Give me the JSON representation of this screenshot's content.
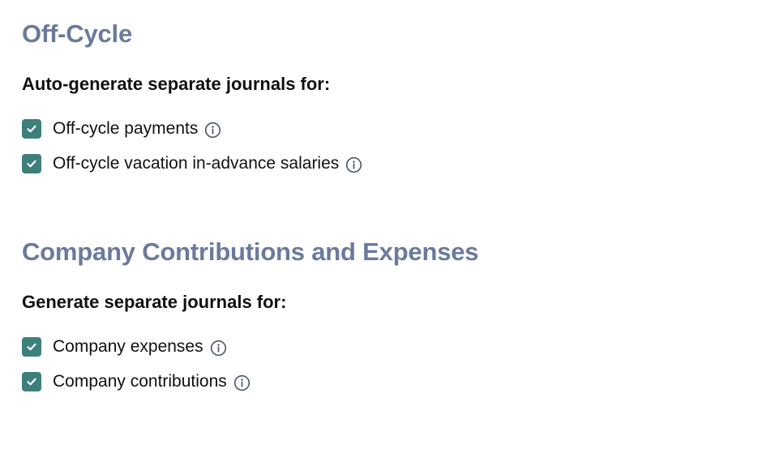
{
  "colors": {
    "section_title": "#6b7a9c",
    "checkbox": "#3d7f7a",
    "text": "#111111"
  },
  "off_cycle": {
    "title": "Off-Cycle",
    "subheading": "Auto-generate separate journals for:",
    "options": [
      {
        "label": "Off-cycle payments",
        "checked": true,
        "icon": "info-icon"
      },
      {
        "label": "Off-cycle vacation in-advance salaries",
        "checked": true,
        "icon": "info-icon"
      }
    ]
  },
  "company": {
    "title": "Company Contributions and Expenses",
    "subheading": "Generate separate journals for:",
    "options": [
      {
        "label": "Company expenses",
        "checked": true,
        "icon": "info-icon"
      },
      {
        "label": "Company contributions",
        "checked": true,
        "icon": "info-icon"
      }
    ]
  }
}
